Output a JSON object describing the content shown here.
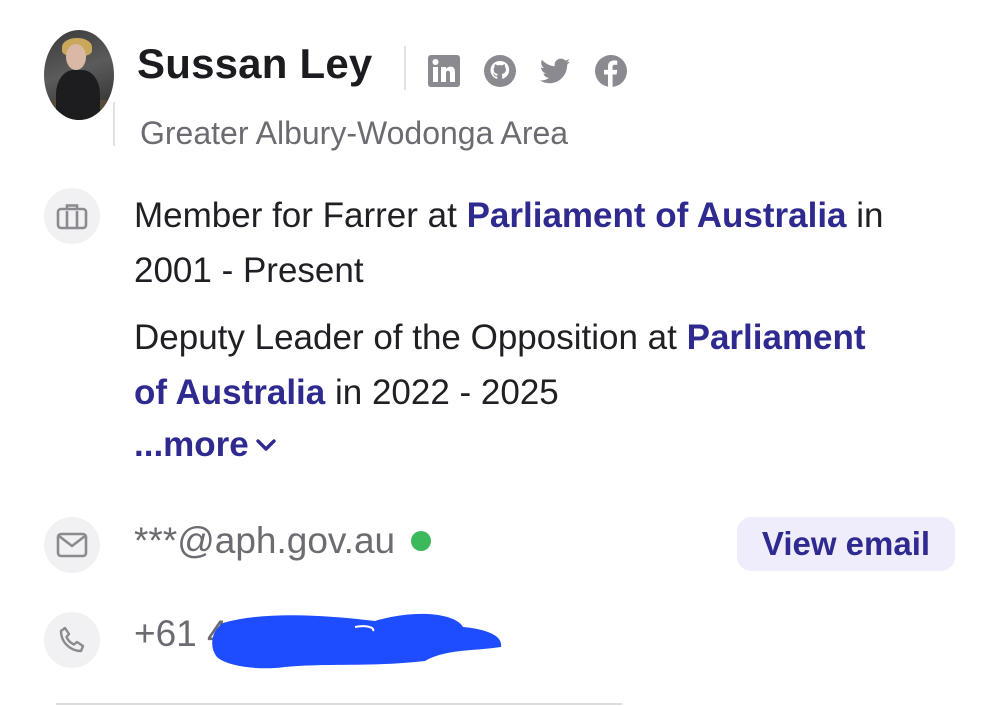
{
  "profile": {
    "name": "Sussan Ley",
    "location": "Greater Albury-Wodonga Area"
  },
  "social_icons": [
    "linkedin-icon",
    "github-icon",
    "twitter-icon",
    "facebook-icon"
  ],
  "experience": [
    {
      "role_prefix": "Member for Farrer at ",
      "org": "Parliament of Australia",
      "period": " in 2001 - Present"
    },
    {
      "role_prefix": "Deputy Leader of the Opposition at ",
      "org": "Parliament of Australia",
      "period": " in 2022 - 2025"
    }
  ],
  "more_label": "...more",
  "contact": {
    "email": "***@aph.gov.au",
    "view_email_label": "View email",
    "phone_prefix": "+61 4"
  },
  "colors": {
    "accent": "#2f2a8f",
    "verified_dot": "#3cb95a",
    "redaction": "#1e4dff",
    "icon_gray": "#8a8a90"
  }
}
